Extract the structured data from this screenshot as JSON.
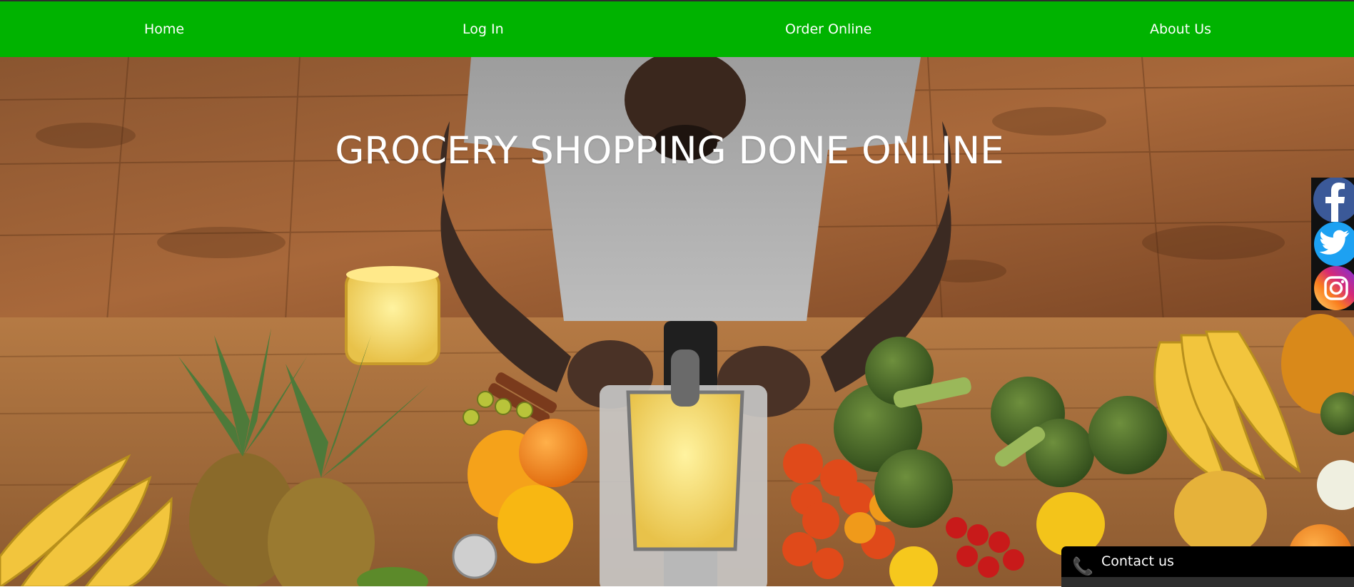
{
  "nav": {
    "home_label": "Home",
    "login_label": "Log In",
    "order_label": "Order Online",
    "about_label": "About Us",
    "background_color": "#00b300"
  },
  "hero": {
    "title": "GROCERY SHOPPING DONE ONLINE"
  },
  "social": {
    "items": [
      {
        "icon": "facebook-icon",
        "color": "#3b5998"
      },
      {
        "icon": "twitter-icon",
        "color": "#1da1f2"
      },
      {
        "icon": "instagram-icon",
        "color": "#c13584"
      }
    ]
  },
  "contact": {
    "label": "Contact us",
    "icon": "phone-icon"
  }
}
